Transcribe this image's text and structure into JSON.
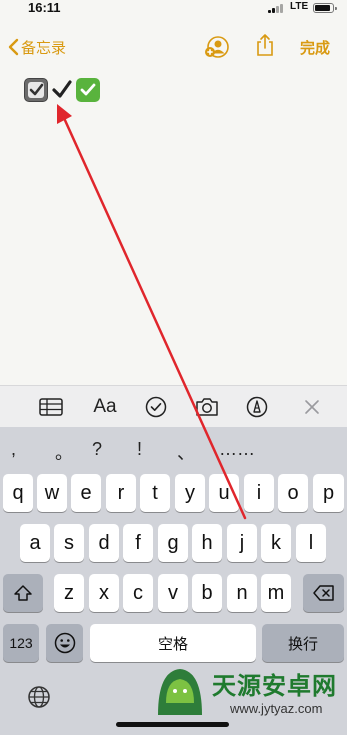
{
  "status": {
    "time": "16:11",
    "network": "LTE"
  },
  "nav": {
    "back_label": "备忘录",
    "done_label": "完成"
  },
  "note": {
    "emojis": [
      "ballot-box-with-check",
      "heavy-check-mark",
      "white-check-mark-button"
    ]
  },
  "toolbar": {
    "format_label": "Aa",
    "icons": [
      "table-icon",
      "text-format-icon",
      "checklist-icon",
      "camera-icon",
      "markup-icon",
      "close-icon"
    ]
  },
  "keyboard": {
    "punctuation": [
      ",",
      "。",
      "?",
      "!",
      "、",
      "……"
    ],
    "row1": [
      "q",
      "w",
      "e",
      "r",
      "t",
      "y",
      "u",
      "i",
      "o",
      "p"
    ],
    "row2": [
      "a",
      "s",
      "d",
      "f",
      "g",
      "h",
      "j",
      "k",
      "l"
    ],
    "row3": [
      "z",
      "x",
      "c",
      "v",
      "b",
      "n",
      "m"
    ],
    "numbers_label": "123",
    "space_label": "空格",
    "return_label": "换行"
  },
  "watermark": {
    "title": "天源安卓网",
    "url": "www.jytyaz.com"
  },
  "colors": {
    "accent": "#d99a12",
    "arrow": "#e0262c",
    "keyboard_bg": "#d1d3d9"
  }
}
